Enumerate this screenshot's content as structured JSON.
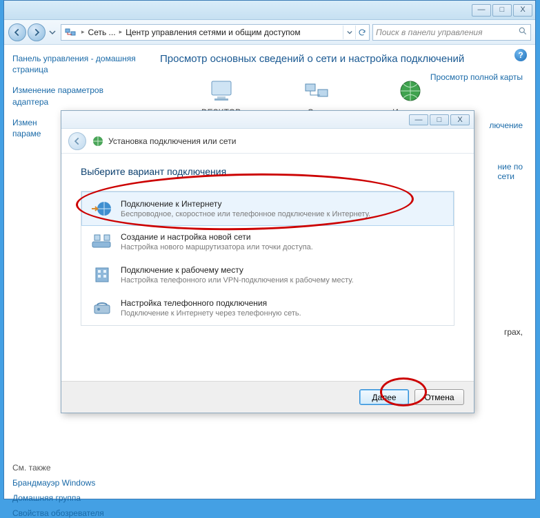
{
  "titlebar": {
    "minimize": "—",
    "maximize": "□",
    "close": "X"
  },
  "toolbar": {
    "breadcrumb_1": "Сеть ...",
    "breadcrumb_2": "Центр управления сетями и общим доступом",
    "search_placeholder": "Поиск в панели управления"
  },
  "sidebar": {
    "link1": "Панель управления - домашняя страница",
    "link2": "Изменение параметров адаптера",
    "link3_a": "Измен",
    "link3_b": "параме",
    "see_also_header": "См. также",
    "sa1": "Брандмауэр Windows",
    "sa2": "Домашняя группа",
    "sa3": "Свойства обозревателя"
  },
  "content": {
    "heading": "Просмотр основных сведений о сети и настройка подключений",
    "map_link": "Просмотр полной карты",
    "nodes": {
      "desktop": "DESKTOP",
      "net": "Сеть",
      "internet": "Интернет"
    },
    "right_link1": "лючение",
    "right_link2_a": "ние по",
    "right_link2_b": "сети",
    "right_link3": "грах,"
  },
  "dialog": {
    "titlebar": {
      "minimize": "—",
      "maximize": "□",
      "close": "X"
    },
    "header_title": "Установка подключения или сети",
    "heading": "Выберите вариант подключения",
    "options": [
      {
        "title": "Подключение к Интернету",
        "desc": "Беспроводное, скоростное или телефонное подключение к Интернету."
      },
      {
        "title": "Создание и настройка новой сети",
        "desc": "Настройка нового маршрутизатора или точки доступа."
      },
      {
        "title": "Подключение к рабочему месту",
        "desc": "Настройка телефонного или VPN-подключения к рабочему месту."
      },
      {
        "title": "Настройка телефонного подключения",
        "desc": "Подключение к Интернету через телефонную сеть."
      }
    ],
    "next_label": "Далее",
    "cancel_label": "Отмена"
  }
}
